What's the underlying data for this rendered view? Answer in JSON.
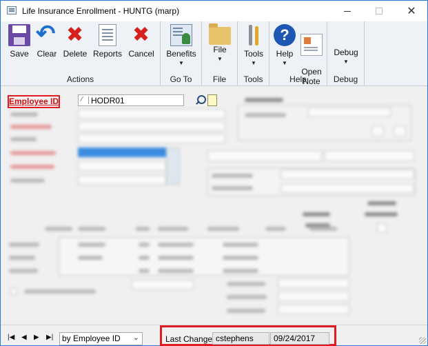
{
  "window": {
    "title": "Life Insurance Enrollment  -  HUNTG (marp)",
    "controls": {
      "minimize": "minimize",
      "maximize": "maximize",
      "close": "✕"
    }
  },
  "ribbon": {
    "groups": [
      {
        "label": "Actions",
        "buttons": [
          "Save",
          "Clear",
          "Delete",
          "Reports",
          "Cancel"
        ]
      },
      {
        "label": "Go To",
        "buttons": [
          "Benefits"
        ]
      },
      {
        "label": "File",
        "buttons": [
          "File"
        ]
      },
      {
        "label": "Tools",
        "buttons": [
          "Tools"
        ]
      },
      {
        "label": "Help",
        "buttons": [
          "Help",
          "Open\nNote"
        ]
      },
      {
        "label": "Debug",
        "buttons": [
          "Debug"
        ]
      }
    ],
    "caret": "▼"
  },
  "form": {
    "employee_id_label": "Employee ID",
    "employee_id_value": "HODR01"
  },
  "statusbar": {
    "nav": [
      "|◀",
      "◀",
      "▶",
      "▶|"
    ],
    "sort_by": "by Employee ID",
    "last_change_label": "Last Change:",
    "last_change_user": "cstephens",
    "last_change_date": "09/24/2017"
  }
}
